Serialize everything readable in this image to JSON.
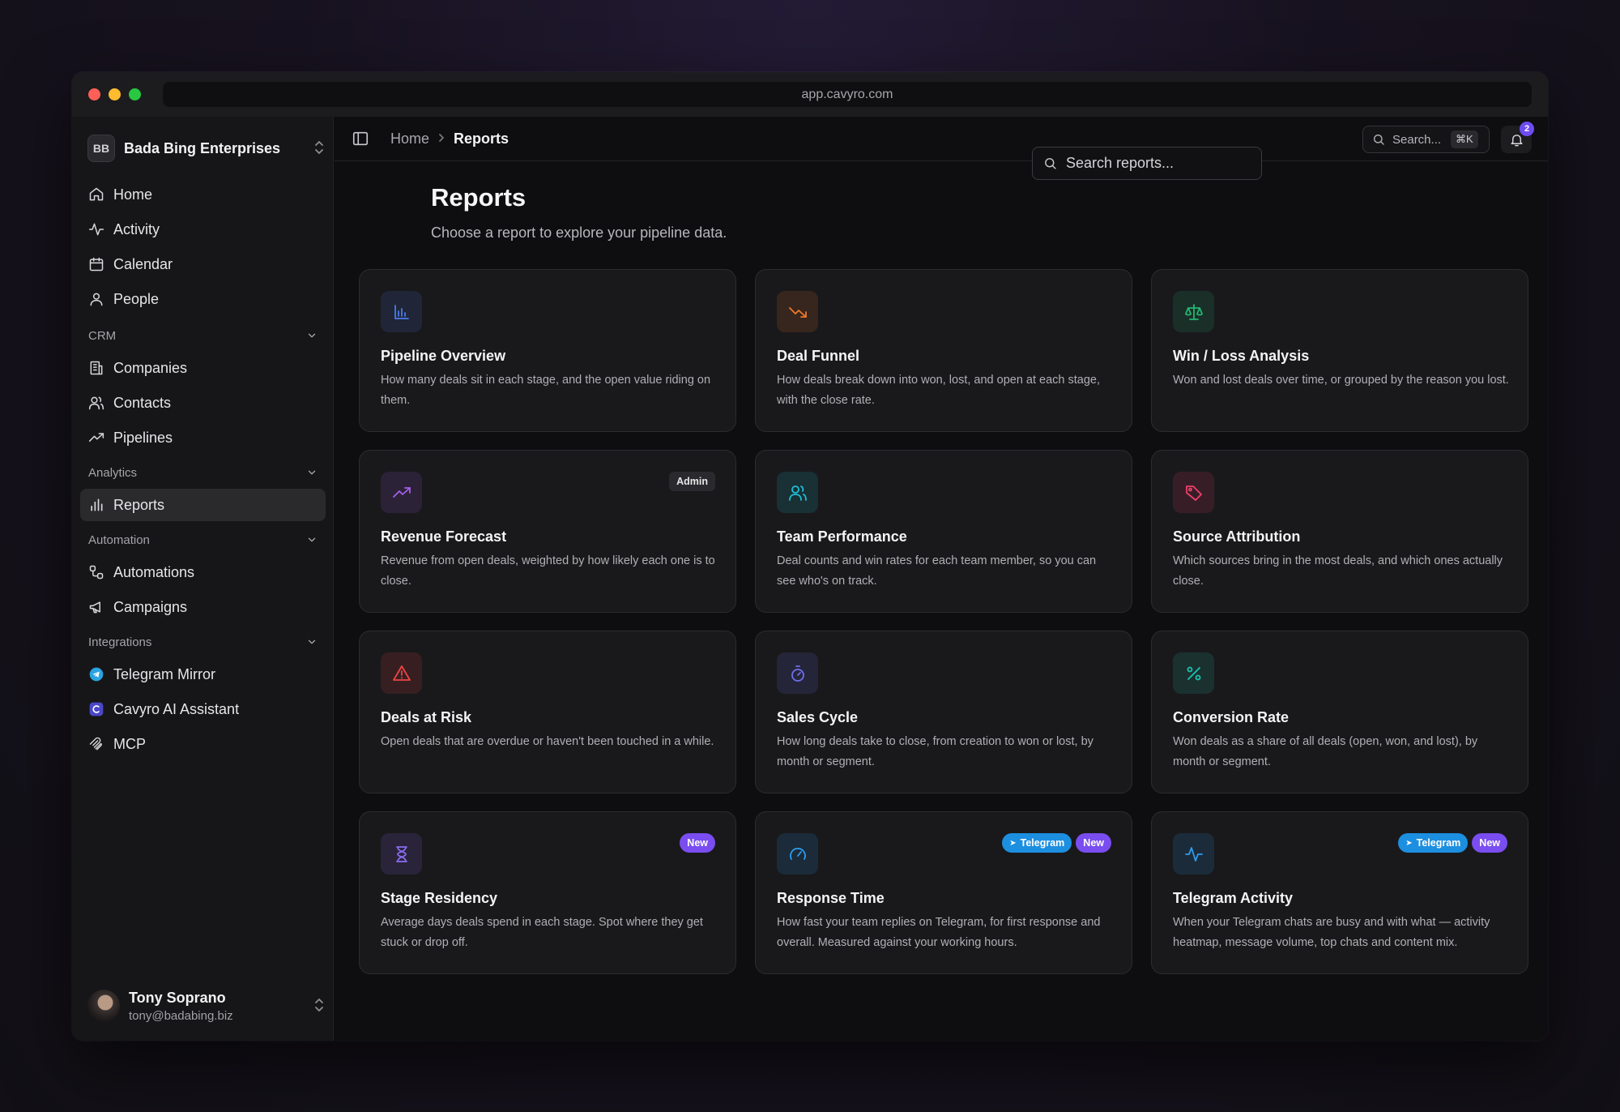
{
  "browser": {
    "url": "app.cavyro.com"
  },
  "workspace": {
    "initials": "BB",
    "name": "Bada Bing Enterprises"
  },
  "nav": {
    "home": "Home",
    "activity": "Activity",
    "calendar": "Calendar",
    "people": "People",
    "crm_section": "CRM",
    "companies": "Companies",
    "contacts": "Contacts",
    "pipelines": "Pipelines",
    "analytics_section": "Analytics",
    "reports": "Reports",
    "automation_section": "Automation",
    "automations": "Automations",
    "campaigns": "Campaigns",
    "integrations_section": "Integrations",
    "telegram_mirror": "Telegram Mirror",
    "cavyro_ai": "Cavyro AI Assistant",
    "mcp": "MCP"
  },
  "user": {
    "name": "Tony Soprano",
    "email": "tony@badabing.biz"
  },
  "topbar": {
    "breadcrumb_home": "Home",
    "breadcrumb_current": "Reports",
    "search_label": "Search...",
    "search_shortcut": "⌘K",
    "notification_count": "2"
  },
  "page": {
    "title": "Reports",
    "subtitle": "Choose a report to explore your pipeline data.",
    "search_placeholder": "Search reports..."
  },
  "cards": [
    {
      "title": "Pipeline Overview",
      "desc": "How many deals sit in each stage, and the open value riding on them.",
      "icon": "bar-chart-icon",
      "color": "#4b7bec"
    },
    {
      "title": "Deal Funnel",
      "desc": "How deals break down into won, lost, and open at each stage, with the close rate.",
      "icon": "trending-down-icon",
      "color": "#f0782a"
    },
    {
      "title": "Win / Loss Analysis",
      "desc": "Won and lost deals over time, or grouped by the reason you lost.",
      "icon": "scale-icon",
      "color": "#22b573"
    },
    {
      "title": "Revenue Forecast",
      "desc": "Revenue from open deals, weighted by how likely each one is to close.",
      "icon": "trending-up-icon",
      "color": "#a45ee8",
      "badges": [
        "Admin"
      ]
    },
    {
      "title": "Team Performance",
      "desc": "Deal counts and win rates for each team member, so you can see who's on track.",
      "icon": "users-icon",
      "color": "#1ec0d8"
    },
    {
      "title": "Source Attribution",
      "desc": "Which sources bring in the most deals, and which ones actually close.",
      "icon": "tag-icon",
      "color": "#ef3f6b"
    },
    {
      "title": "Deals at Risk",
      "desc": "Open deals that are overdue or haven't been touched in a while.",
      "icon": "alert-triangle-icon",
      "color": "#ef4444"
    },
    {
      "title": "Sales Cycle",
      "desc": "How long deals take to close, from creation to won or lost, by month or segment.",
      "icon": "timer-icon",
      "color": "#6e6ef0"
    },
    {
      "title": "Conversion Rate",
      "desc": "Won deals as a share of all deals (open, won, and lost), by month or segment.",
      "icon": "percent-icon",
      "color": "#20c4b0"
    },
    {
      "title": "Stage Residency",
      "desc": "Average days deals spend in each stage. Spot where they get stuck or drop off.",
      "icon": "hourglass-icon",
      "color": "#8b6cf0",
      "badges": [
        "New"
      ]
    },
    {
      "title": "Response Time",
      "desc": "How fast your team replies on Telegram, for first response and overall. Measured against your working hours.",
      "icon": "gauge-icon",
      "color": "#2d9cf0",
      "badges": [
        "Telegram",
        "New"
      ]
    },
    {
      "title": "Telegram Activity",
      "desc": "When your Telegram chats are busy and with what — activity heatmap, message volume, top chats and content mix.",
      "icon": "activity-icon",
      "color": "#2d9cf0",
      "badges": [
        "Telegram",
        "New"
      ]
    }
  ]
}
